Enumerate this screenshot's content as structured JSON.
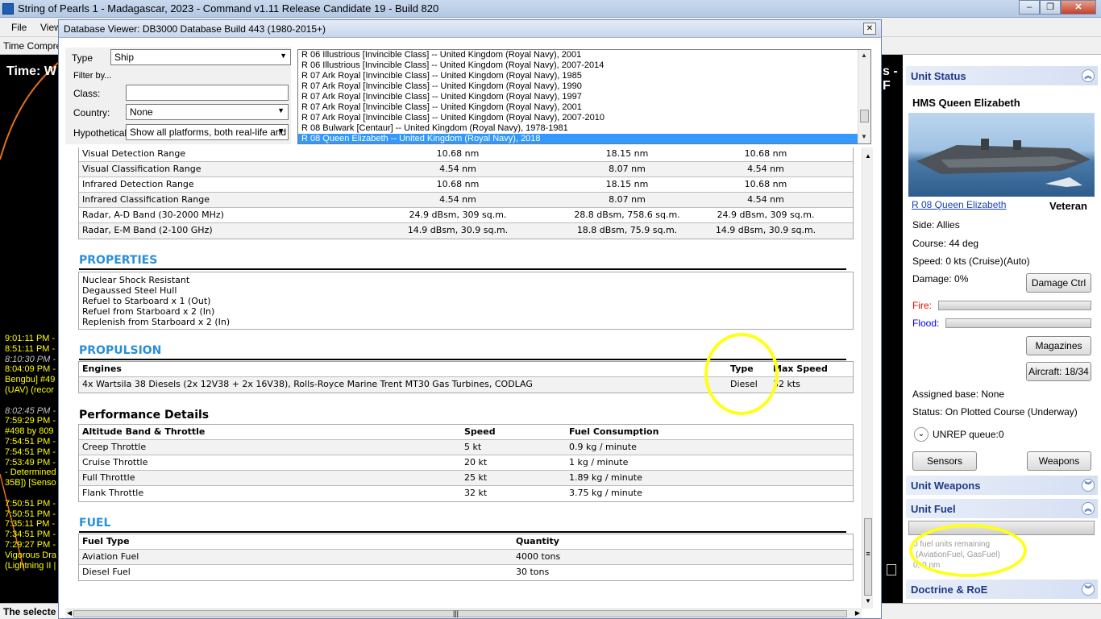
{
  "window": {
    "title": "String of Pearls 1 - Madagascar, 2023 - Command v1.11 Release Candidate 19 - Build 820",
    "min": "–",
    "max": "❐",
    "close": "✕"
  },
  "menubar": {
    "file": "File",
    "view": "View"
  },
  "toolbar": {
    "time_compression": "Time Compres"
  },
  "map": {
    "time_label": "Time: W",
    "right_fragment": "s - F"
  },
  "message_log": [
    "9:01:11 PM -",
    "8:51:11 PM -",
    "8:10:30 PM -",
    "8:04:09 PM -",
    "Bengbu] #49",
    "(UAV) (recor",
    "",
    "8:02:45 PM -",
    "7:59:29 PM -",
    "#498 by 809",
    "7:54:51 PM -",
    "7:54:51 PM -",
    "7:53:49 PM -",
    "- Determined",
    "35B]) [Senso",
    "",
    "7:50:51 PM -",
    "7:50:51 PM -",
    "7:35:11 PM -",
    "7:34:51 PM -",
    "7:29:27 PM -",
    "Vigorous Dra",
    "(Lightning II |"
  ],
  "statusbar": {
    "text": "The selecte"
  },
  "dialog": {
    "title": "Database Viewer: DB3000 Database Build 443 (1980-2015+)",
    "close": "✕",
    "filters": {
      "type_label": "Type",
      "type_value": "Ship",
      "filter_by_label": "Filter by...",
      "class_label": "Class:",
      "class_value": "",
      "country_label": "Country:",
      "country_value": "None",
      "hypothetical_label": "Hypothetical:",
      "hypothetical_value": "Show all platforms, both real-life and h"
    },
    "platform_list": [
      "R 06 Illustrious [Invincible Class] -- United Kingdom (Royal Navy), 2001",
      "R 06 Illustrious [Invincible Class] -- United Kingdom (Royal Navy), 2007-2014",
      "R 07 Ark Royal [Invincible Class] -- United Kingdom (Royal Navy), 1985",
      "R 07 Ark Royal [Invincible Class] -- United Kingdom (Royal Navy), 1990",
      "R 07 Ark Royal [Invincible Class] -- United Kingdom (Royal Navy), 1997",
      "R 07 Ark Royal [Invincible Class] -- United Kingdom (Royal Navy), 2001",
      "R 07 Ark Royal [Invincible Class] -- United Kingdom (Royal Navy), 2007-2010",
      "R 08 Bulwark [Centaur] -- United Kingdom (Royal Navy), 1978-1981",
      "R 08 Queen Elizabeth -- United Kingdom (Royal Navy), 2018"
    ],
    "selected_index": 8,
    "signature_rows": [
      [
        "Visual Detection Range",
        "10.68 nm",
        "18.15 nm",
        "10.68 nm"
      ],
      [
        "Visual Classification Range",
        "4.54 nm",
        "8.07 nm",
        "4.54 nm"
      ],
      [
        "Infrared Detection Range",
        "10.68 nm",
        "18.15 nm",
        "10.68 nm"
      ],
      [
        "Infrared Classification Range",
        "4.54 nm",
        "8.07 nm",
        "4.54 nm"
      ],
      [
        "Radar, A-D Band (30-2000 MHz)",
        "24.9 dBsm, 309 sq.m.",
        "28.8 dBsm, 758.6 sq.m.",
        "24.9 dBsm, 309 sq.m."
      ],
      [
        "Radar, E-M Band (2-100 GHz)",
        "14.9 dBsm, 30.9 sq.m.",
        "18.8 dBsm, 75.9 sq.m.",
        "14.9 dBsm, 30.9 sq.m."
      ]
    ],
    "properties": {
      "heading": "PROPERTIES",
      "items": [
        "Nuclear Shock Resistant",
        "Degaussed Steel Hull",
        "Refuel to Starboard x 1 (Out)",
        "Refuel from Starboard x 2 (In)",
        "Replenish from Starboard x 2 (In)"
      ]
    },
    "propulsion": {
      "heading": "PROPULSION",
      "col_engines": "Engines",
      "col_type": "Type",
      "col_max_speed": "Max Speed",
      "engine": "4x Wartsila 38 Diesels (2x 12V38 + 2x 16V38), Rolls-Royce Marine Trent MT30 Gas Turbines, CODLAG",
      "type": "Diesel",
      "max_speed": "32 kts"
    },
    "performance": {
      "heading": "Performance Details",
      "col_band": "Altitude Band & Throttle",
      "col_speed": "Speed",
      "col_fuel": "Fuel Consumption",
      "rows": [
        [
          "Creep Throttle",
          "5 kt",
          "0.9 kg / minute"
        ],
        [
          "Cruise Throttle",
          "20 kt",
          "1 kg / minute"
        ],
        [
          "Full Throttle",
          "25 kt",
          "1.89 kg / minute"
        ],
        [
          "Flank Throttle",
          "32 kt",
          "3.75 kg / minute"
        ]
      ]
    },
    "fuel": {
      "heading": "FUEL",
      "col_type": "Fuel Type",
      "col_quantity": "Quantity",
      "rows": [
        [
          "Aviation Fuel",
          "4000 tons"
        ],
        [
          "Diesel Fuel",
          "30 tons"
        ]
      ]
    },
    "scroll_thumb": "≡",
    "hscroll_grip": "|||"
  },
  "unit_panel": {
    "status_header": "Unit Status",
    "unit_name": "HMS Queen Elizabeth",
    "class_link": "R 08 Queen Elizabeth",
    "proficiency": "Veteran",
    "side": "Side: Allies",
    "course": "Course: 44 deg",
    "speed": "Speed: 0 kts (Cruise)",
    "speed_mode": "(Auto)",
    "damage": "Damage: 0%",
    "damage_ctrl_btn": "Damage Ctrl",
    "fire_label": "Fire:",
    "flood_label": "Flood:",
    "fire_level": 0,
    "flood_level": 0,
    "magazines_btn": "Magazines",
    "aircraft_btn": "Aircraft: 18/34",
    "assigned_base": "Assigned base: None",
    "status": "Status: On Plotted Course (Underway)",
    "unrep": "UNREP queue:0",
    "sensors_btn": "Sensors",
    "weapons_btn": "Weapons",
    "weapons_header": "Unit Weapons",
    "fuel_header": "Unit Fuel",
    "fuel_line1": "0 fuel units remaining",
    "fuel_line2": "(AviationFuel, GasFuel)",
    "fuel_line3": "0, 0 nm",
    "doctrine_header": "Doctrine & RoE",
    "colors": {
      "fire": "#ff0000",
      "flood": "#0000ff",
      "header_text": "#1f3a84"
    }
  },
  "annotation_color": "#ffff1a"
}
